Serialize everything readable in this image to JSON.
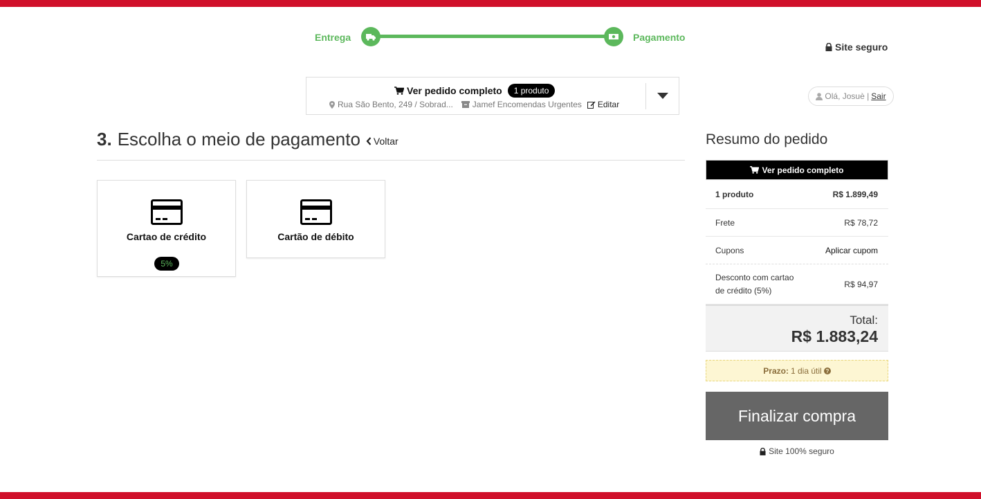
{
  "header": {
    "steps": [
      {
        "label": "Entrega",
        "icon": "truck-icon"
      },
      {
        "label": "Pagamento",
        "icon": "money-icon"
      }
    ],
    "secure_label": "Site seguro",
    "accent_color": "#5cb85c",
    "brand_color": "#d0102a"
  },
  "order": {
    "title": "Ver pedido completo",
    "badge": "1 produto",
    "address": "Rua São Bento, 249 / Sobrad...",
    "shipping": "Jamef Encomendas Urgentes",
    "edit_label": "Editar"
  },
  "user": {
    "greeting": "Olá, Josuè |",
    "logout": "Sair"
  },
  "page": {
    "step_number": "3.",
    "title": "Escolha o meio de pagamento",
    "back_label": "Voltar"
  },
  "payment_methods": [
    {
      "label": "Cartao de crédito",
      "badge": "5%"
    },
    {
      "label": "Cartão de débito"
    }
  ],
  "summary": {
    "title": "Resumo do pedido",
    "view_order_label": "Ver pedido completo",
    "rows": [
      {
        "label": "1 produto",
        "value": "R$ 1.899,49"
      },
      {
        "label": "Frete",
        "value": "R$ 78,72"
      },
      {
        "label": "Cupons",
        "value": "Aplicar cupom"
      },
      {
        "label": "Desconto com cartao de crédito (5%)",
        "value": "R$ 94,97"
      }
    ],
    "total_label": "Total:",
    "total_value": "R$ 1.883,24",
    "prazo_label": "Prazo:",
    "prazo_value": "1 dia útil",
    "checkout_label": "Finalizar compra",
    "secure_label": "Site 100% seguro"
  }
}
